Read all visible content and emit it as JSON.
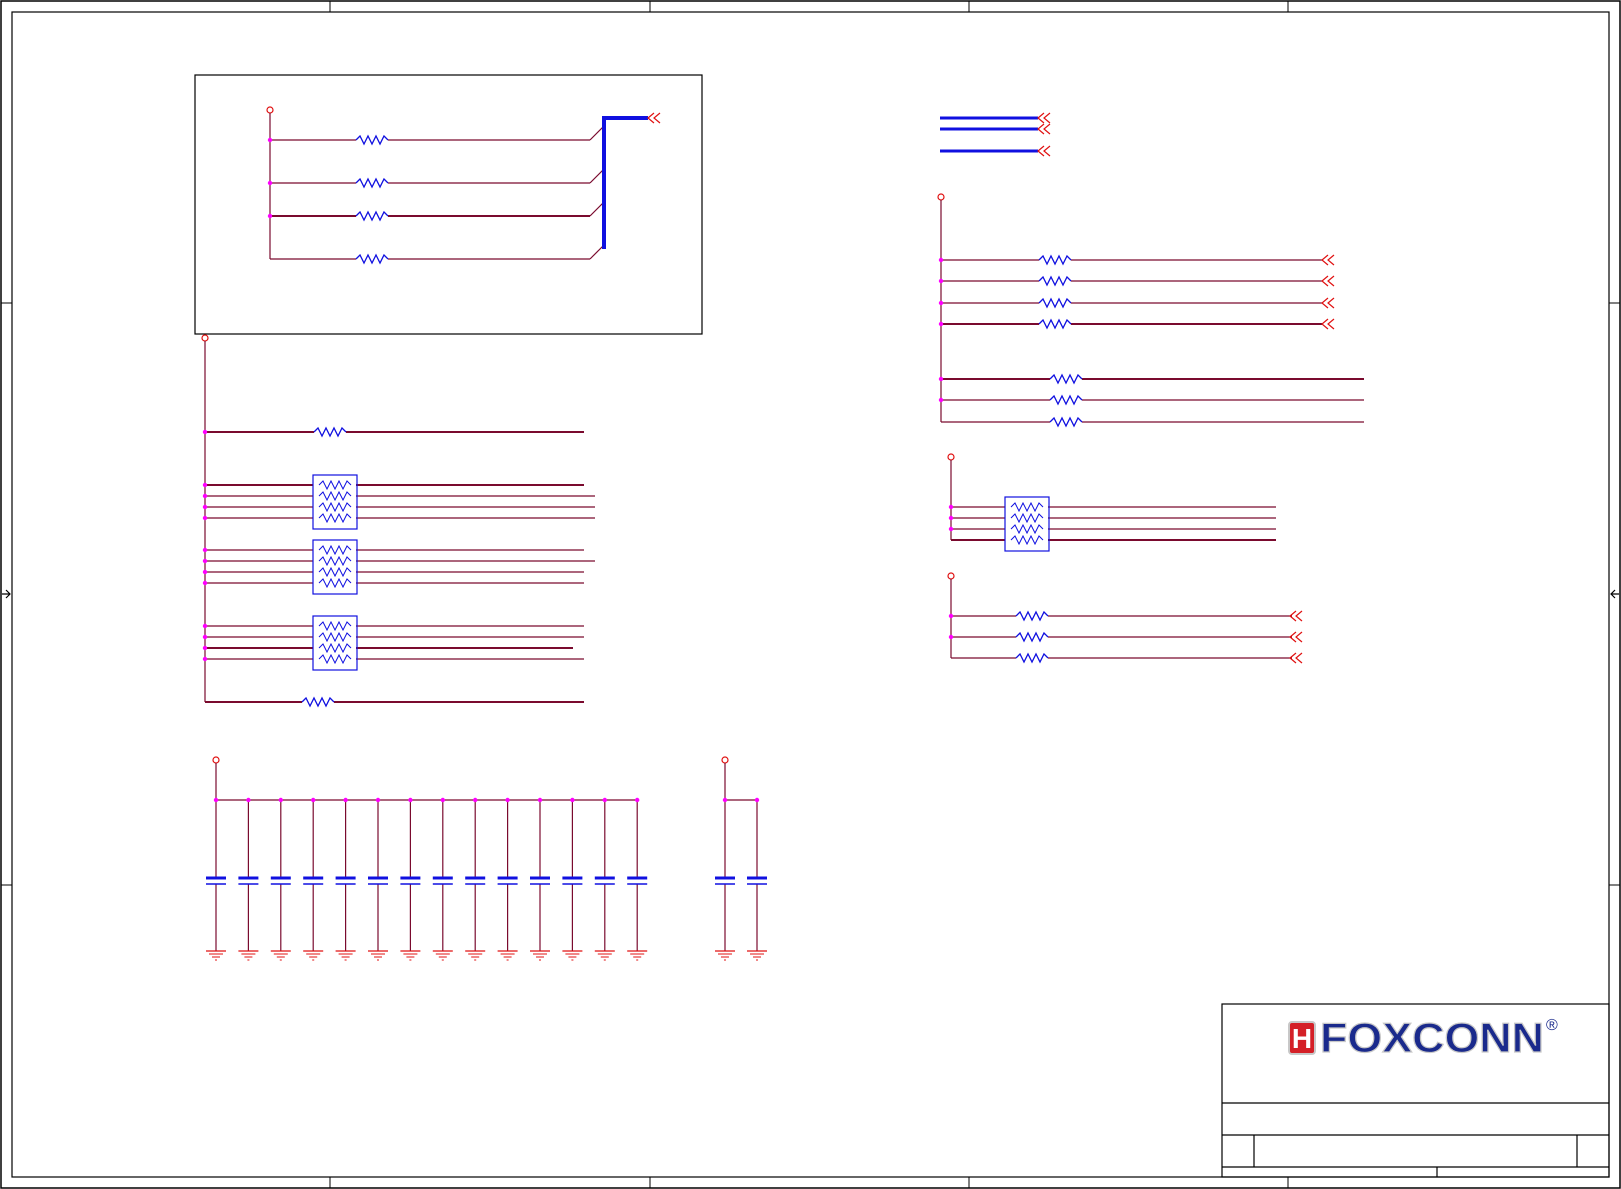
{
  "logo": {
    "text": "FOXCONN",
    "mark_letter": "H",
    "registered": "®",
    "colors": {
      "text": "#1a2a8c",
      "mark": "#d42027",
      "outline": "#c8c8c8"
    }
  },
  "colors": {
    "wire": "#7a0a2e",
    "component": "#1010e0",
    "pin_dot": "#ff00ff",
    "power": "#e01010",
    "frame": "#000000"
  }
}
